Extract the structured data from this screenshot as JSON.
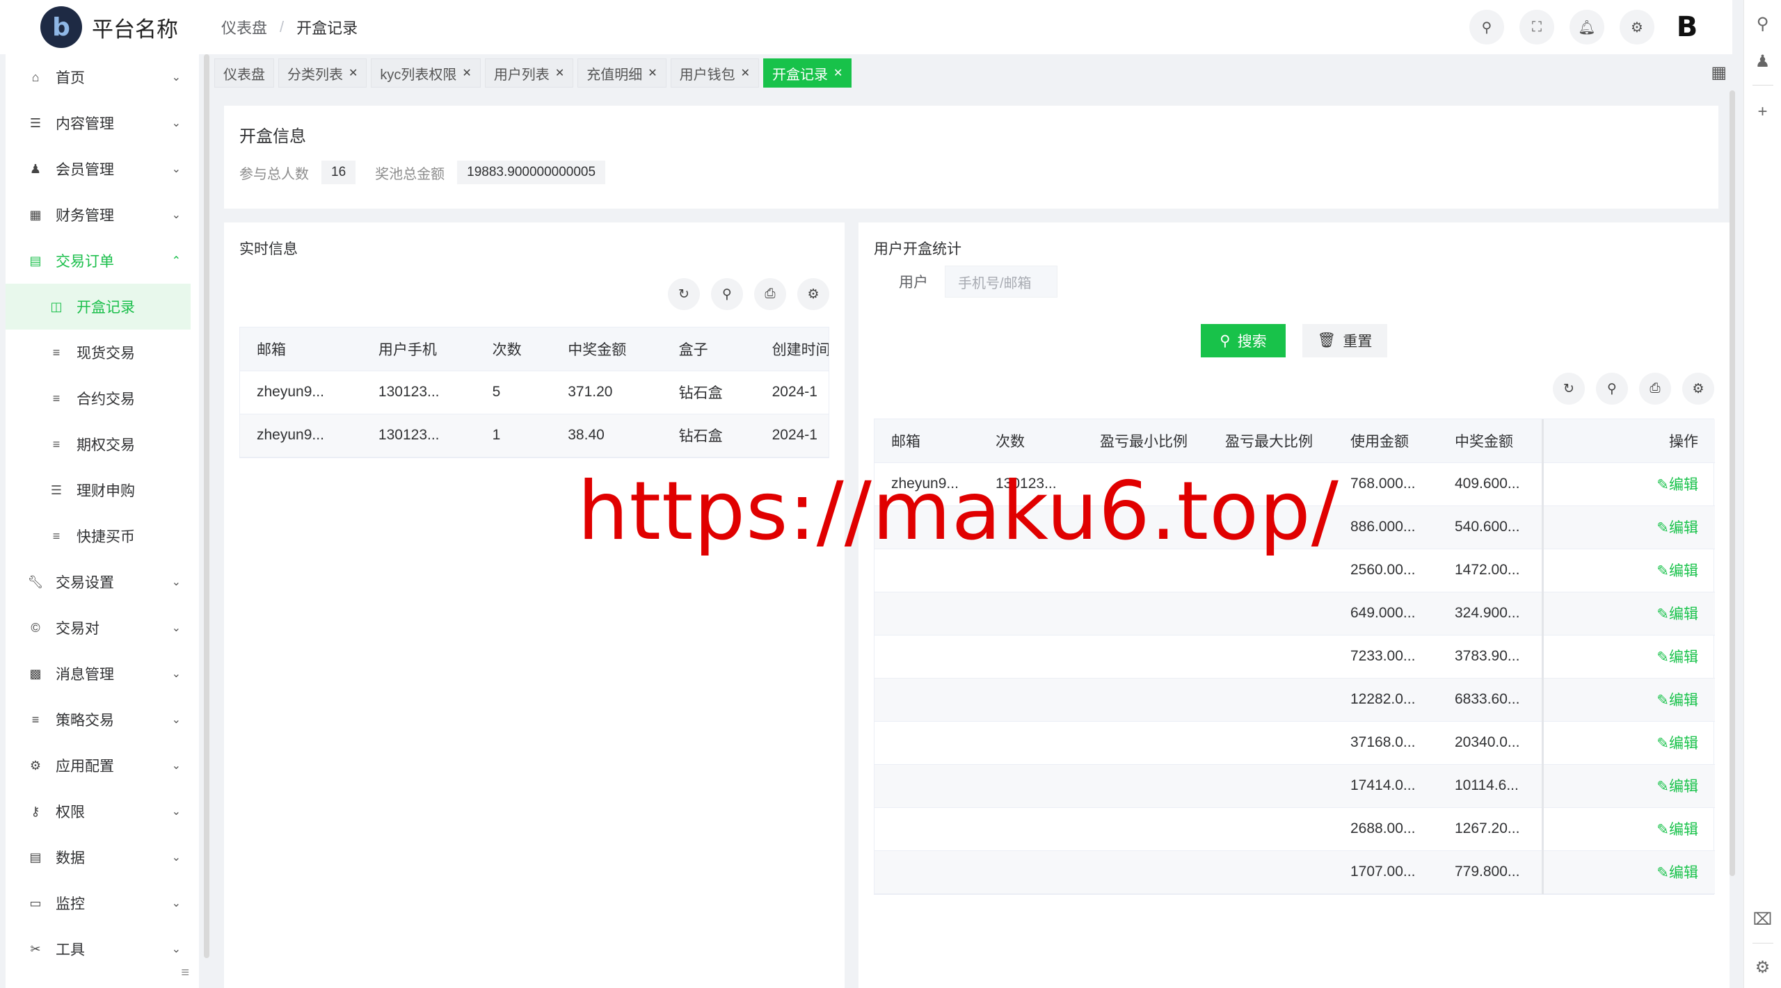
{
  "header": {
    "logo_letter": "b",
    "platform_name": "平台名称",
    "breadcrumb": [
      "仪表盘",
      "开盒记录"
    ],
    "brand_glyph": "B"
  },
  "sidebar": {
    "items": [
      {
        "label": "首页",
        "icon": "home-icon"
      },
      {
        "label": "内容管理",
        "icon": "list-icon"
      },
      {
        "label": "会员管理",
        "icon": "user-icon"
      },
      {
        "label": "财务管理",
        "icon": "finance-icon"
      },
      {
        "label": "交易订单",
        "icon": "order-icon",
        "open": true
      }
    ],
    "sub_items": [
      {
        "label": "开盒记录",
        "active": true
      },
      {
        "label": "现货交易"
      },
      {
        "label": "合约交易"
      },
      {
        "label": "期权交易"
      },
      {
        "label": "理财申购"
      },
      {
        "label": "快捷买币"
      }
    ],
    "items_after": [
      {
        "label": "交易设置",
        "icon": "wrench-icon"
      },
      {
        "label": "交易对",
        "icon": "copyright-icon"
      },
      {
        "label": "消息管理",
        "icon": "message-icon"
      },
      {
        "label": "策略交易",
        "icon": "list-icon"
      },
      {
        "label": "应用配置",
        "icon": "config-icon"
      },
      {
        "label": "权限",
        "icon": "permission-icon"
      },
      {
        "label": "数据",
        "icon": "data-icon"
      },
      {
        "label": "监控",
        "icon": "monitor-icon"
      },
      {
        "label": "工具",
        "icon": "tools-icon"
      }
    ]
  },
  "tabs": [
    {
      "label": "仪表盘",
      "closable": false
    },
    {
      "label": "分类列表",
      "closable": true
    },
    {
      "label": "kyc列表权限",
      "closable": true
    },
    {
      "label": "用户列表",
      "closable": true
    },
    {
      "label": "充值明细",
      "closable": true
    },
    {
      "label": "用户钱包",
      "closable": true
    },
    {
      "label": "开盒记录",
      "closable": true,
      "active": true
    }
  ],
  "info": {
    "title": "开盒信息",
    "participants_label": "参与总人数",
    "participants_value": "16",
    "pool_label": "奖池总金额",
    "pool_value": "19883.900000000005"
  },
  "realtime": {
    "title": "实时信息",
    "columns": [
      "邮箱",
      "用户手机",
      "次数",
      "中奖金额",
      "盒子",
      "创建时间"
    ],
    "rows": [
      [
        "zheyun9...",
        "130123...",
        "5",
        "371.20",
        "钻石盒",
        "2024-1"
      ],
      [
        "zheyun9...",
        "130123...",
        "1",
        "38.40",
        "钻石盒",
        "2024-1"
      ]
    ]
  },
  "stats": {
    "title": "用户开盒统计",
    "user_label": "用户",
    "user_placeholder": "手机号/邮箱",
    "search_label": "搜索",
    "reset_label": "重置",
    "columns": [
      "邮箱",
      "次数",
      "盈亏最小比例",
      "盈亏最大比例",
      "使用金额",
      "中奖金额",
      "操作"
    ],
    "edit_label": "编辑",
    "rows": [
      [
        "zheyun9...",
        "130123...",
        "",
        "",
        "768.000...",
        "409.600..."
      ],
      [
        "",
        "",
        "",
        "",
        "886.000...",
        "540.600..."
      ],
      [
        "",
        "",
        "",
        "",
        "2560.00...",
        "1472.00..."
      ],
      [
        "",
        "",
        "",
        "",
        "649.000...",
        "324.900..."
      ],
      [
        "",
        "",
        "",
        "",
        "7233.00...",
        "3783.90..."
      ],
      [
        "",
        "",
        "",
        "",
        "12282.0...",
        "6833.60..."
      ],
      [
        "",
        "",
        "",
        "",
        "37168.0...",
        "20340.0..."
      ],
      [
        "",
        "",
        "",
        "",
        "17414.0...",
        "10114.6..."
      ],
      [
        "",
        "",
        "",
        "",
        "2688.00...",
        "1267.20..."
      ],
      [
        "",
        "",
        "",
        "",
        "1707.00...",
        "779.800..."
      ]
    ]
  },
  "watermark": "https://maku6.top/"
}
